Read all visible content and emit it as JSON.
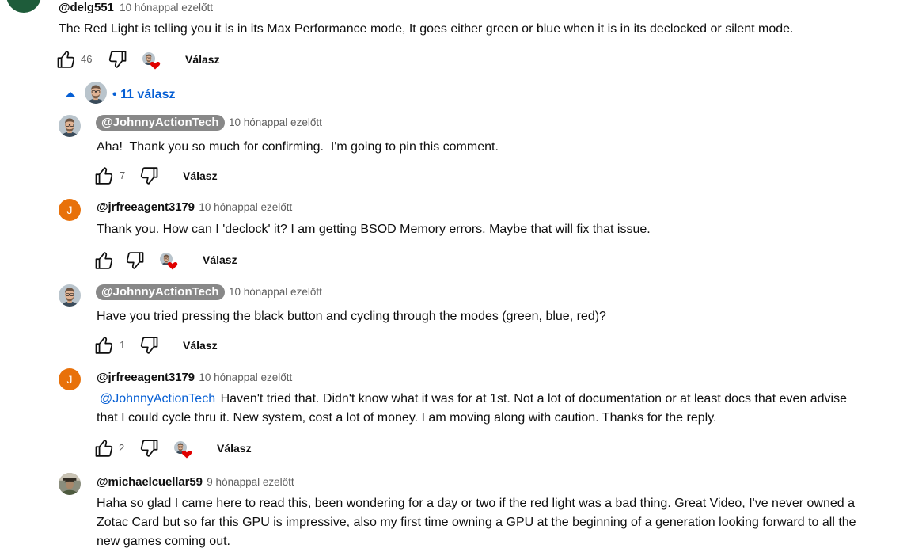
{
  "colors": {
    "link": "#065fd4",
    "creator_pill": "#888888",
    "avatar_j": "#e8710a",
    "top_avatar": "#1e5c3a",
    "heart": "#e00000"
  },
  "top_comment": {
    "author": "@delg551",
    "time": "10 hónappal ezelőtt",
    "text": "The Red Light is telling you it is in its Max Performance mode, It goes either green or blue when it is in its declocked or silent mode.",
    "likes": "46",
    "reply_label": "Válasz",
    "icons": [
      "like-icon",
      "dislike-icon",
      "creator-heart-icon"
    ]
  },
  "replies_toggle": {
    "label": "11 válasz",
    "bullet": "•",
    "icon": "caret-up-icon"
  },
  "replies": [
    {
      "author": "@JohnnyActionTech",
      "time": "10 hónappal ezelőtt",
      "text": "Aha!  Thank you so much for confirming.  I'm going to pin this comment.",
      "likes": "7",
      "reply_label": "Válasz"
    },
    {
      "author": "@jrfreeagent3179",
      "avatar_letter": "J",
      "time": "10 hónappal ezelőtt",
      "text": "Thank you. How can I 'declock' it? I am getting BSOD Memory errors. Maybe that will fix that issue.",
      "likes": "",
      "reply_label": "Válasz"
    },
    {
      "author": "@JohnnyActionTech",
      "time": "10 hónappal ezelőtt",
      "text": "Have you tried pressing the black button and cycling through the modes (green, blue, red)?",
      "likes": "1",
      "reply_label": "Válasz"
    },
    {
      "author": "@jrfreeagent3179",
      "avatar_letter": "J",
      "time": "10 hónappal ezelőtt",
      "mention": "@JohnnyActionTech",
      "text_line1": "Haven't tried that. Didn't know what it was for at 1st. Not a lot of documentation or at least docs that even advise",
      "text_line2": "that I could cycle thru it. New system, cost a lot of money. I am moving along with caution. Thanks for the reply.",
      "likes": "2",
      "reply_label": "Válasz"
    },
    {
      "author": "@michaelcuellar59",
      "time": "9 hónappal ezelőtt",
      "text_line1": "Haha so glad I came here to read this, been wondering for a day or two if the red light was a bad thing. Great Video, I've never owned a",
      "text_line2": "Zotac Card but so far this GPU is impressive, also my first time owning a GPU at the beginning of a generation looking forward to all the",
      "text_line3": "new games coming out."
    }
  ]
}
